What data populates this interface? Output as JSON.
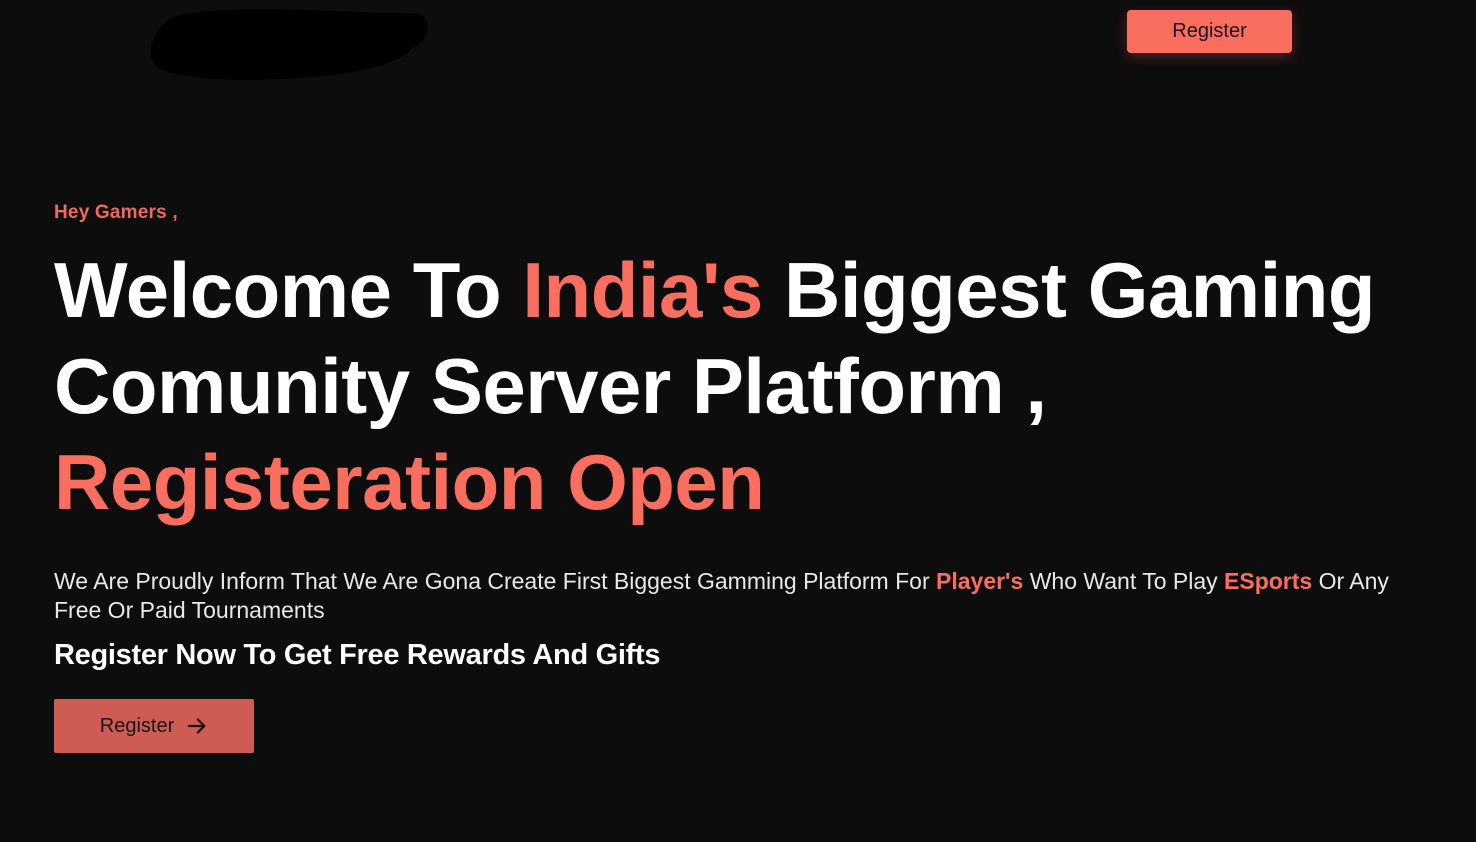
{
  "header": {
    "register_label": "Register"
  },
  "hero": {
    "greeting": "Hey Gamers ,",
    "headline": {
      "part1": "Welcome To ",
      "accent1": "India's",
      "part2": " Biggest Gaming Comunity Server Platform ,",
      "accent2": "Registeration Open"
    },
    "description": {
      "part1": "We Are Proudly Inform That We Are Gona Create First Biggest Gamming Platform For ",
      "highlight1": "Player's",
      "part2": " Who Want To Play ",
      "highlight2": "ESports",
      "part3": " Or Any Free Or Paid Tournaments"
    },
    "subheading": "Register Now To Get Free Rewards And Gifts",
    "cta_label": "Register",
    "cta_icon": "arrow-right-icon"
  },
  "colors": {
    "background": "#0e0d0e",
    "accent": "#fa6e5f",
    "cta": "#cf5c52",
    "text": "#ffffff"
  }
}
